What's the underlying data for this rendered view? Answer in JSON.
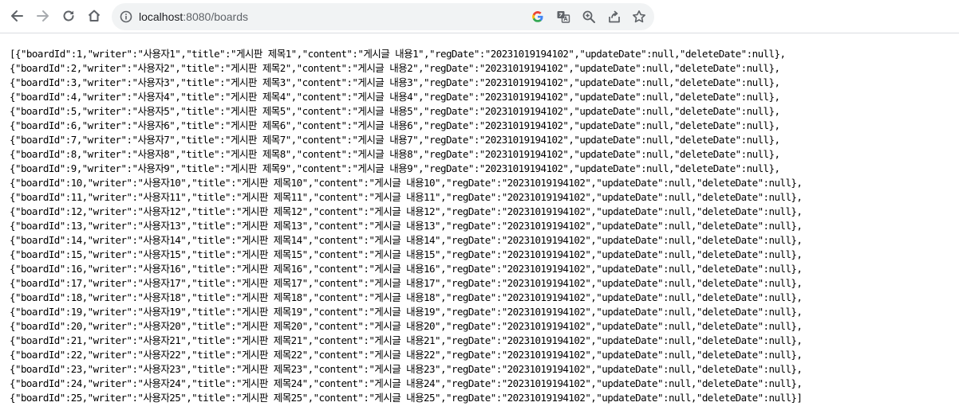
{
  "browser": {
    "url_host": "localhost",
    "url_port": ":8080",
    "url_path": "/boards"
  },
  "icons": {
    "back": "arrow-left-icon",
    "forward": "arrow-right-icon",
    "reload": "reload-icon",
    "home": "home-icon",
    "site_info": "info-circle-icon",
    "google": "google-icon",
    "translate": "translate-icon",
    "zoom": "zoom-in-icon",
    "share": "share-icon",
    "bookmark": "star-icon"
  },
  "colors": {
    "text": "#000000",
    "toolbar_icon": "#5f6368",
    "omnibox_bg": "#f1f3f4"
  },
  "response_lines": [
    "[{\"boardId\":1,\"writer\":\"사용자1\",\"title\":\"게시판 제목1\",\"content\":\"게시글 내용1\",\"regDate\":\"20231019194102\",\"updateDate\":null,\"deleteDate\":null},",
    "{\"boardId\":2,\"writer\":\"사용자2\",\"title\":\"게시판 제목2\",\"content\":\"게시글 내용2\",\"regDate\":\"20231019194102\",\"updateDate\":null,\"deleteDate\":null},",
    "{\"boardId\":3,\"writer\":\"사용자3\",\"title\":\"게시판 제목3\",\"content\":\"게시글 내용3\",\"regDate\":\"20231019194102\",\"updateDate\":null,\"deleteDate\":null},",
    "{\"boardId\":4,\"writer\":\"사용자4\",\"title\":\"게시판 제목4\",\"content\":\"게시글 내용4\",\"regDate\":\"20231019194102\",\"updateDate\":null,\"deleteDate\":null},",
    "{\"boardId\":5,\"writer\":\"사용자5\",\"title\":\"게시판 제목5\",\"content\":\"게시글 내용5\",\"regDate\":\"20231019194102\",\"updateDate\":null,\"deleteDate\":null},",
    "{\"boardId\":6,\"writer\":\"사용자6\",\"title\":\"게시판 제목6\",\"content\":\"게시글 내용6\",\"regDate\":\"20231019194102\",\"updateDate\":null,\"deleteDate\":null},",
    "{\"boardId\":7,\"writer\":\"사용자7\",\"title\":\"게시판 제목7\",\"content\":\"게시글 내용7\",\"regDate\":\"20231019194102\",\"updateDate\":null,\"deleteDate\":null},",
    "{\"boardId\":8,\"writer\":\"사용자8\",\"title\":\"게시판 제목8\",\"content\":\"게시글 내용8\",\"regDate\":\"20231019194102\",\"updateDate\":null,\"deleteDate\":null},",
    "{\"boardId\":9,\"writer\":\"사용자9\",\"title\":\"게시판 제목9\",\"content\":\"게시글 내용9\",\"regDate\":\"20231019194102\",\"updateDate\":null,\"deleteDate\":null},",
    "{\"boardId\":10,\"writer\":\"사용자10\",\"title\":\"게시판 제목10\",\"content\":\"게시글 내용10\",\"regDate\":\"20231019194102\",\"updateDate\":null,\"deleteDate\":null},",
    "{\"boardId\":11,\"writer\":\"사용자11\",\"title\":\"게시판 제목11\",\"content\":\"게시글 내용11\",\"regDate\":\"20231019194102\",\"updateDate\":null,\"deleteDate\":null},",
    "{\"boardId\":12,\"writer\":\"사용자12\",\"title\":\"게시판 제목12\",\"content\":\"게시글 내용12\",\"regDate\":\"20231019194102\",\"updateDate\":null,\"deleteDate\":null},",
    "{\"boardId\":13,\"writer\":\"사용자13\",\"title\":\"게시판 제목13\",\"content\":\"게시글 내용13\",\"regDate\":\"20231019194102\",\"updateDate\":null,\"deleteDate\":null},",
    "{\"boardId\":14,\"writer\":\"사용자14\",\"title\":\"게시판 제목14\",\"content\":\"게시글 내용14\",\"regDate\":\"20231019194102\",\"updateDate\":null,\"deleteDate\":null},",
    "{\"boardId\":15,\"writer\":\"사용자15\",\"title\":\"게시판 제목15\",\"content\":\"게시글 내용15\",\"regDate\":\"20231019194102\",\"updateDate\":null,\"deleteDate\":null},",
    "{\"boardId\":16,\"writer\":\"사용자16\",\"title\":\"게시판 제목16\",\"content\":\"게시글 내용16\",\"regDate\":\"20231019194102\",\"updateDate\":null,\"deleteDate\":null},",
    "{\"boardId\":17,\"writer\":\"사용자17\",\"title\":\"게시판 제목17\",\"content\":\"게시글 내용17\",\"regDate\":\"20231019194102\",\"updateDate\":null,\"deleteDate\":null},",
    "{\"boardId\":18,\"writer\":\"사용자18\",\"title\":\"게시판 제목18\",\"content\":\"게시글 내용18\",\"regDate\":\"20231019194102\",\"updateDate\":null,\"deleteDate\":null},",
    "{\"boardId\":19,\"writer\":\"사용자19\",\"title\":\"게시판 제목19\",\"content\":\"게시글 내용19\",\"regDate\":\"20231019194102\",\"updateDate\":null,\"deleteDate\":null},",
    "{\"boardId\":20,\"writer\":\"사용자20\",\"title\":\"게시판 제목20\",\"content\":\"게시글 내용20\",\"regDate\":\"20231019194102\",\"updateDate\":null,\"deleteDate\":null},",
    "{\"boardId\":21,\"writer\":\"사용자21\",\"title\":\"게시판 제목21\",\"content\":\"게시글 내용21\",\"regDate\":\"20231019194102\",\"updateDate\":null,\"deleteDate\":null},",
    "{\"boardId\":22,\"writer\":\"사용자22\",\"title\":\"게시판 제목22\",\"content\":\"게시글 내용22\",\"regDate\":\"20231019194102\",\"updateDate\":null,\"deleteDate\":null},",
    "{\"boardId\":23,\"writer\":\"사용자23\",\"title\":\"게시판 제목23\",\"content\":\"게시글 내용23\",\"regDate\":\"20231019194102\",\"updateDate\":null,\"deleteDate\":null},",
    "{\"boardId\":24,\"writer\":\"사용자24\",\"title\":\"게시판 제목24\",\"content\":\"게시글 내용24\",\"regDate\":\"20231019194102\",\"updateDate\":null,\"deleteDate\":null},",
    "{\"boardId\":25,\"writer\":\"사용자25\",\"title\":\"게시판 제목25\",\"content\":\"게시글 내용25\",\"regDate\":\"20231019194102\",\"updateDate\":null,\"deleteDate\":null}]"
  ]
}
